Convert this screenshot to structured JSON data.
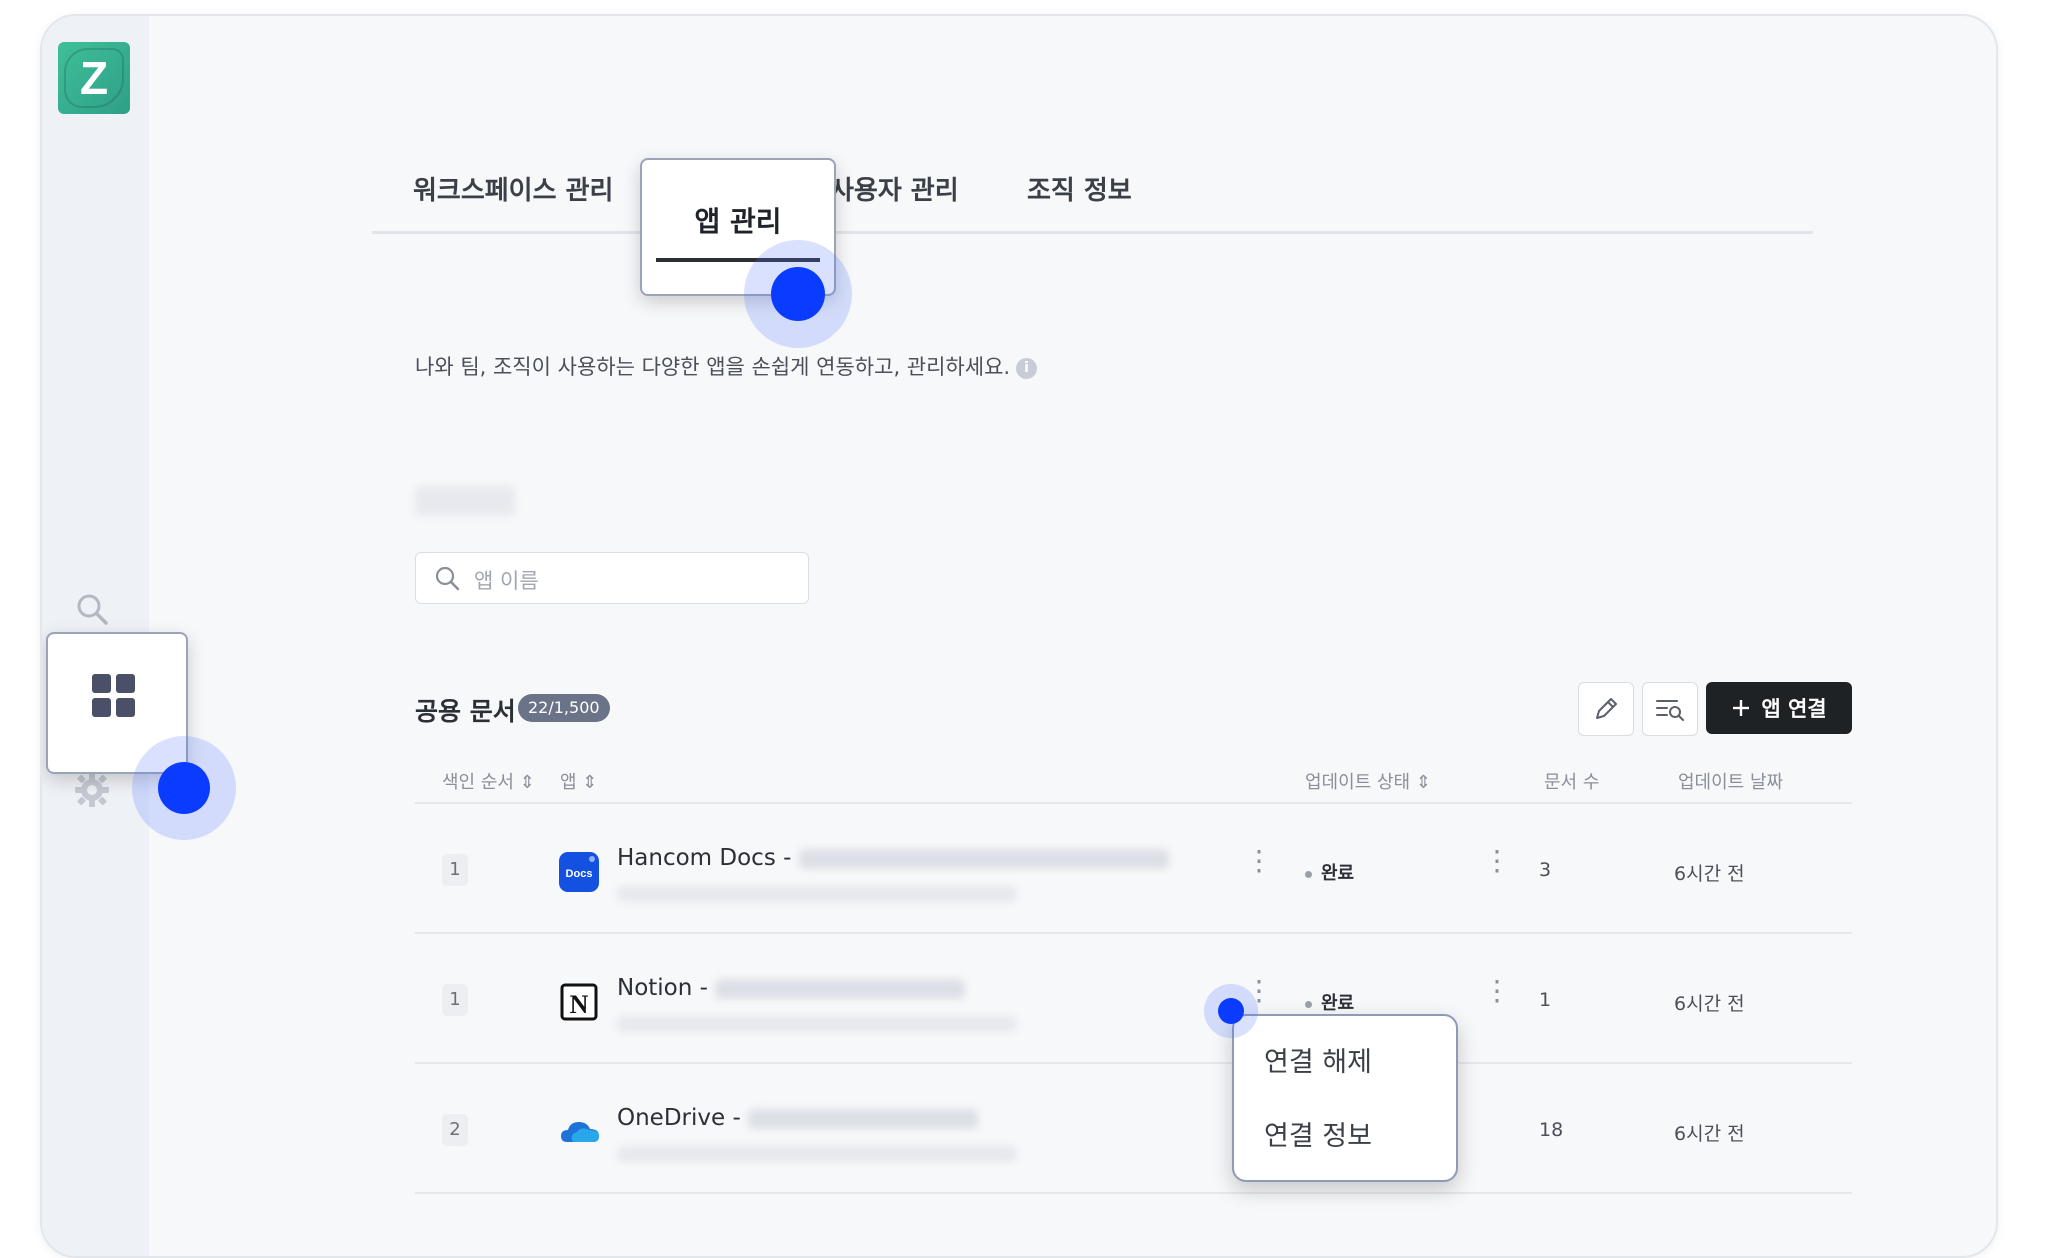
{
  "logo": {
    "letter": "Z"
  },
  "tabs": [
    {
      "label": "워크스페이스 관리"
    },
    {
      "label": "앱 관리",
      "active": true
    },
    {
      "label": "사용자 관리"
    },
    {
      "label": "조직 정보"
    }
  ],
  "description": "나와 팀, 조직이 사용하는 다양한 앱을 손쉽게 연동하고, 관리하세요.",
  "search": {
    "placeholder": "앱 이름"
  },
  "section": {
    "title": "공용 문서",
    "badge": "22/1,500"
  },
  "toolbar": {
    "connect_label": "앱 연결"
  },
  "table": {
    "headers": {
      "index_order": "색인 순서",
      "app": "앱",
      "update_status": "업데이트 상태",
      "doc_count": "문서 수",
      "update_date": "업데이트 날짜"
    },
    "rows": [
      {
        "index": "1",
        "app": "Hancom Docs - ",
        "status": "완료",
        "count": "3",
        "date": "6시간 전"
      },
      {
        "index": "1",
        "app": "Notion - ",
        "status": "완료",
        "count": "1",
        "date": "6시간 전"
      },
      {
        "index": "2",
        "app": "OneDrive - ",
        "count": "18",
        "date": "6시간 전"
      }
    ]
  },
  "context_menu": {
    "items": [
      "연결 해제",
      "연결 정보"
    ]
  },
  "colors": {
    "accent_dot": "#0a3cff",
    "primary_button": "#1f2225",
    "badge": "#6b7388"
  }
}
